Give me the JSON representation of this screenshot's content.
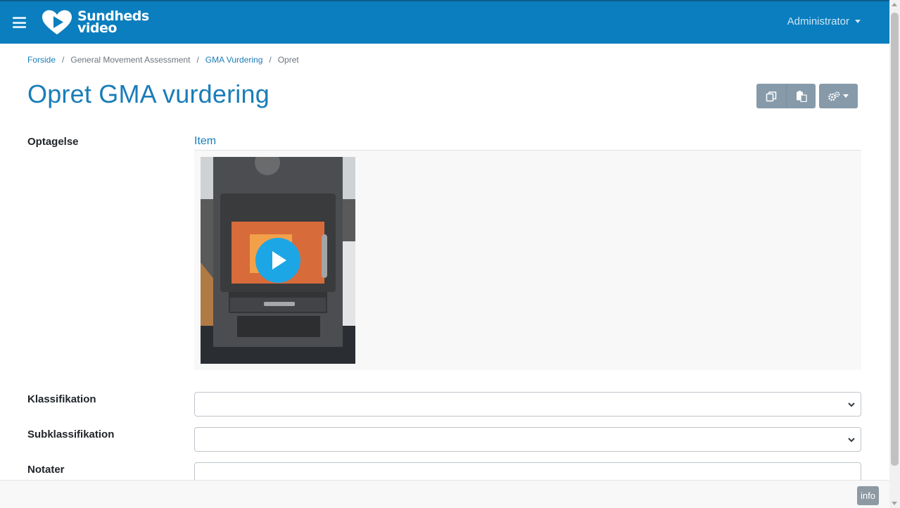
{
  "app": {
    "logo_line1": "Sundheds",
    "logo_line2": "video",
    "user_menu": "Administrator"
  },
  "breadcrumb": {
    "home": "Forside",
    "section": "General Movement Assessment",
    "parent": "GMA Vurdering",
    "current": "Opret"
  },
  "page": {
    "title": "Opret GMA vurdering"
  },
  "form": {
    "recording_label": "Optagelse",
    "recording_card_title": "Item",
    "classification_label": "Klassifikation",
    "subclassification_label": "Subklassifikation",
    "notes_label": "Notater"
  },
  "footer": {
    "info_label": "info"
  },
  "colors": {
    "topbar": "#0a7ebf",
    "link": "#1a7db8",
    "toolbar_button": "#869aaa",
    "play_button": "#1ca6e6"
  }
}
